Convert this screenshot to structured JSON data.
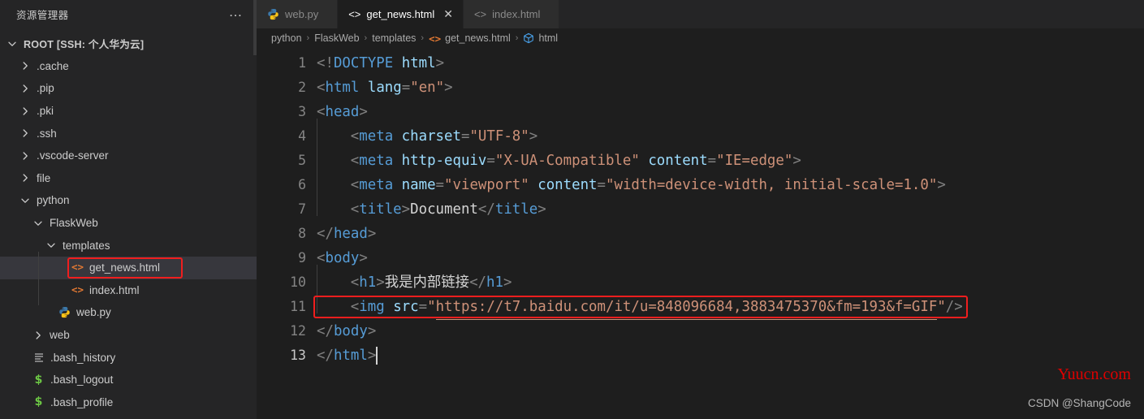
{
  "sidebar": {
    "title": "资源管理器",
    "more_label": "…",
    "more_icon": "ellipsis-icon",
    "tree": [
      {
        "label": "ROOT [SSH: 个人华为云]",
        "type": "root",
        "indent": 0,
        "twisty": "down",
        "icon": "none"
      },
      {
        "label": ".cache",
        "type": "folder",
        "indent": 1,
        "twisty": "right",
        "icon": "none"
      },
      {
        "label": ".pip",
        "type": "folder",
        "indent": 1,
        "twisty": "right",
        "icon": "none"
      },
      {
        "label": ".pki",
        "type": "folder",
        "indent": 1,
        "twisty": "right",
        "icon": "none"
      },
      {
        "label": ".ssh",
        "type": "folder",
        "indent": 1,
        "twisty": "right",
        "icon": "none"
      },
      {
        "label": ".vscode-server",
        "type": "folder",
        "indent": 1,
        "twisty": "right",
        "icon": "none"
      },
      {
        "label": "file",
        "type": "folder",
        "indent": 1,
        "twisty": "right",
        "icon": "none"
      },
      {
        "label": "python",
        "type": "folder",
        "indent": 1,
        "twisty": "down",
        "icon": "none"
      },
      {
        "label": "FlaskWeb",
        "type": "folder",
        "indent": 2,
        "twisty": "down",
        "icon": "none"
      },
      {
        "label": "templates",
        "type": "folder",
        "indent": 3,
        "twisty": "down",
        "icon": "none"
      },
      {
        "label": "get_news.html",
        "type": "file",
        "indent": 4,
        "twisty": "none",
        "icon": "html-icon",
        "selected": true,
        "boxed": true
      },
      {
        "label": "index.html",
        "type": "file",
        "indent": 4,
        "twisty": "none",
        "icon": "html-icon"
      },
      {
        "label": "web.py",
        "type": "file",
        "indent": 3,
        "twisty": "none",
        "icon": "python-icon"
      },
      {
        "label": "web",
        "type": "folder",
        "indent": 2,
        "twisty": "right",
        "icon": "none"
      },
      {
        "label": ".bash_history",
        "type": "file",
        "indent": 1,
        "twisty": "none",
        "icon": "lines-icon"
      },
      {
        "label": ".bash_logout",
        "type": "file",
        "indent": 1,
        "twisty": "none",
        "icon": "shell-icon"
      },
      {
        "label": ".bash_profile",
        "type": "file",
        "indent": 1,
        "twisty": "none",
        "icon": "shell-icon"
      }
    ]
  },
  "tabs": [
    {
      "label": "web.py",
      "icon": "python-icon",
      "active": false,
      "closable": false
    },
    {
      "label": "get_news.html",
      "icon": "html-icon",
      "active": true,
      "closable": true,
      "close_label": "✕"
    },
    {
      "label": "index.html",
      "icon": "html-icon",
      "active": false,
      "closable": false
    }
  ],
  "breadcrumb": [
    {
      "label": "python",
      "icon": "none"
    },
    {
      "label": "FlaskWeb",
      "icon": "none"
    },
    {
      "label": "templates",
      "icon": "none"
    },
    {
      "label": "get_news.html",
      "icon": "html-icon"
    },
    {
      "label": "html",
      "icon": "symbol-cube-icon"
    }
  ],
  "breadcrumb_separator": "›",
  "code": {
    "language": "html",
    "active_line": 13,
    "lines": [
      {
        "n": "1",
        "indent": 0,
        "guides": 0
      },
      {
        "n": "2",
        "indent": 0,
        "guides": 0
      },
      {
        "n": "3",
        "indent": 0,
        "guides": 0
      },
      {
        "n": "4",
        "indent": 1,
        "guides": 1
      },
      {
        "n": "5",
        "indent": 1,
        "guides": 1
      },
      {
        "n": "6",
        "indent": 1,
        "guides": 1
      },
      {
        "n": "7",
        "indent": 1,
        "guides": 1
      },
      {
        "n": "8",
        "indent": 0,
        "guides": 0
      },
      {
        "n": "9",
        "indent": 0,
        "guides": 0
      },
      {
        "n": "10",
        "indent": 1,
        "guides": 1
      },
      {
        "n": "11",
        "indent": 1,
        "guides": 1
      },
      {
        "n": "12",
        "indent": 0,
        "guides": 0
      },
      {
        "n": "13",
        "indent": 0,
        "guides": 0
      }
    ],
    "text": {
      "l1_doctype_open": "<!",
      "l1_doctype_kw": "DOCTYPE",
      "l1_doctype_name": " html",
      "l1_close": ">",
      "l2_open": "<",
      "l2_tag": "html",
      "l2_sp": " ",
      "l2_attr": "lang",
      "l2_eq": "=",
      "l2_val": "\"en\"",
      "l2_close": ">",
      "l3_open": "<",
      "l3_tag": "head",
      "l3_close": ">",
      "l4_open": "<",
      "l4_tag": "meta",
      "l4_sp": " ",
      "l4_attr": "charset",
      "l4_eq": "=",
      "l4_val": "\"UTF-8\"",
      "l4_close": ">",
      "l5_open": "<",
      "l5_tag": "meta",
      "l5_sp": " ",
      "l5_attr": "http-equiv",
      "l5_eq": "=",
      "l5_val": "\"X-UA-Compatible\"",
      "l5_sp2": " ",
      "l5_attr2": "content",
      "l5_eq2": "=",
      "l5_val2": "\"IE=edge\"",
      "l5_close": ">",
      "l6_open": "<",
      "l6_tag": "meta",
      "l6_sp": " ",
      "l6_attr": "name",
      "l6_eq": "=",
      "l6_val": "\"viewport\"",
      "l6_sp2": " ",
      "l6_attr2": "content",
      "l6_eq2": "=",
      "l6_val2": "\"width=device-width, initial-scale=1.0\"",
      "l6_close": ">",
      "l7_open": "<",
      "l7_tag": "title",
      "l7_gt": ">",
      "l7_txt": "Document",
      "l7_endopen": "</",
      "l7_endtag": "title",
      "l7_close": ">",
      "l8_open": "</",
      "l8_tag": "head",
      "l8_close": ">",
      "l9_open": "<",
      "l9_tag": "body",
      "l9_close": ">",
      "l10_open": "<",
      "l10_tag": "h1",
      "l10_gt": ">",
      "l10_txt": "我是内部链接",
      "l10_endopen": "</",
      "l10_endtag": "h1",
      "l10_close": ">",
      "l11_open": "<",
      "l11_tag": "img",
      "l11_sp": " ",
      "l11_attr": "src",
      "l11_eq": "=",
      "l11_q1": "\"",
      "l11_url": "https://t7.baidu.com/it/u=848096684,3883475370&fm=193&f=GIF",
      "l11_q2": "\"",
      "l11_close": "/>",
      "l12_open": "</",
      "l12_tag": "body",
      "l12_close": ">",
      "l13_open": "</",
      "l13_tag": "html",
      "l13_close": ">"
    }
  },
  "watermarks": {
    "primary": "Yuucn.com",
    "secondary": "CSDN @ShangCode"
  },
  "colors": {
    "editor_bg": "#1e1e1e",
    "sidebar_bg": "#252526",
    "tab_inactive_bg": "#2d2d2d",
    "selection_bg": "#37373d",
    "tag": "#569cd6",
    "attr": "#9cdcfe",
    "value": "#ce9178",
    "punct": "#808080",
    "text": "#d4d4d4",
    "highlight_box": "#f01e1e",
    "html_icon": "#e37933",
    "shell_icon": "#6cc644",
    "watermark_red": "#e00000"
  }
}
